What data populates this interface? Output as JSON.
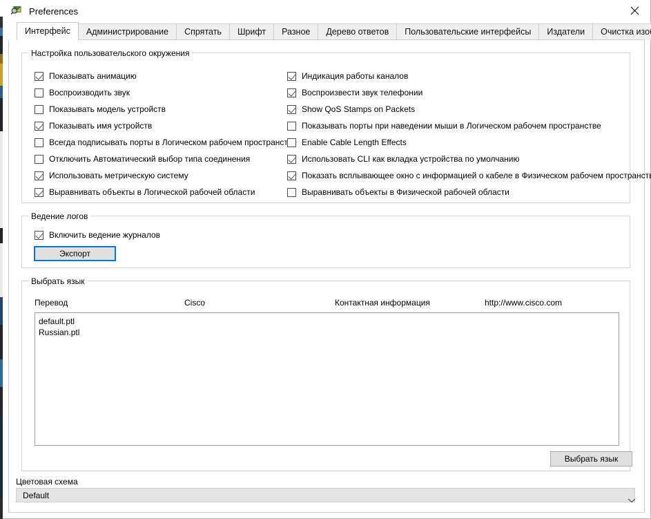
{
  "window": {
    "title": "Preferences",
    "icon": "packet-tracer-icon",
    "close_label": "✕"
  },
  "tabs": [
    {
      "label": "Интерфейс",
      "active": true
    },
    {
      "label": "Администрирование",
      "active": false
    },
    {
      "label": "Спрятать",
      "active": false
    },
    {
      "label": "Шрифт",
      "active": false
    },
    {
      "label": "Разное",
      "active": false
    },
    {
      "label": "Дерево ответов",
      "active": false
    },
    {
      "label": "Пользовательские интерфейсы",
      "active": false
    },
    {
      "label": "Издатели",
      "active": false
    },
    {
      "label": "Очистка изображений",
      "active": false
    }
  ],
  "environment_group": {
    "legend": "Настройка пользовательского окружения",
    "left_column": [
      {
        "label": "Показывать анимацию",
        "checked": true
      },
      {
        "label": "Воспроизводить звук",
        "checked": false
      },
      {
        "label": "Показывать модель устройств",
        "checked": false
      },
      {
        "label": "Показывать имя устройств",
        "checked": true
      },
      {
        "label": "Всегда подписывать порты в Логическом рабочем пространстве",
        "checked": false
      },
      {
        "label": "Отключить Автоматический выбор типа соединения",
        "checked": false
      },
      {
        "label": "Использовать метрическую систему",
        "checked": true
      },
      {
        "label": "Выравнивать объекты в Логической рабочей области",
        "checked": true
      }
    ],
    "right_column": [
      {
        "label": "Индикация работы каналов",
        "checked": true
      },
      {
        "label": "Воспроизвести звук телефонии",
        "checked": true
      },
      {
        "label": "Show QoS Stamps on Packets",
        "checked": true
      },
      {
        "label": "Показывать порты при наведении мыши в Логическом рабочем пространстве",
        "checked": false
      },
      {
        "label": "Enable Cable Length Effects",
        "checked": false
      },
      {
        "label": "Использовать CLI как вкладка устройства по умолчанию",
        "checked": true
      },
      {
        "label": "Показать всплывающее окно с информацией о кабеле в Физическом рабочем пространстве",
        "checked": true
      },
      {
        "label": "Выравнивать объекты в Физической рабочей области",
        "checked": false
      }
    ]
  },
  "logging_group": {
    "legend": "Ведение логов",
    "enable_logging": {
      "label": "Включить ведение журналов",
      "checked": true
    },
    "export_button": "Экспорт"
  },
  "language_group": {
    "legend": "Выбрать язык",
    "columns": [
      "Перевод",
      "Cisco",
      "Контактная информация",
      "http://www.cisco.com"
    ],
    "items": [
      "default.ptl",
      "Russian.ptl"
    ],
    "select_button": "Выбрать язык"
  },
  "color_scheme": {
    "label": "Цветовая схема",
    "value": "Default",
    "chevron": "chevron-down-icon"
  },
  "colors": {
    "focus_blue": "#0078d7",
    "button_face": "#e1e1e1",
    "group_border": "#d5d5d5",
    "window_bg": "#ffffff"
  }
}
